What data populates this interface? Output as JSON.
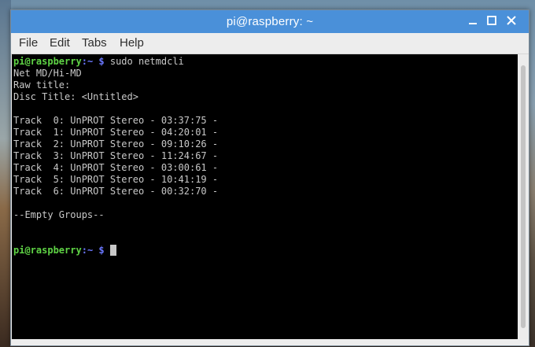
{
  "window": {
    "title": "pi@raspberry: ~"
  },
  "menu": {
    "file": "File",
    "edit": "Edit",
    "tabs": "Tabs",
    "help": "Help"
  },
  "terminal": {
    "prompt_user": "pi@raspberry",
    "prompt_sep": ":",
    "prompt_path": "~",
    "prompt_symbol": " $",
    "command": " sudo netmdcli",
    "lines": [
      "Net MD/Hi-MD",
      "Raw title:",
      "Disc Title: <Untitled>",
      "",
      "Track  0: UnPROT Stereo - 03:37:75 -",
      "Track  1: UnPROT Stereo - 04:20:01 -",
      "Track  2: UnPROT Stereo - 09:10:26 -",
      "Track  3: UnPROT Stereo - 11:24:67 -",
      "Track  4: UnPROT Stereo - 03:00:61 -",
      "Track  5: UnPROT Stereo - 10:41:19 -",
      "Track  6: UnPROT Stereo - 00:32:70 -",
      "",
      "--Empty Groups--"
    ]
  },
  "colors": {
    "titlebar": "#4a90d9",
    "prompt_user": "#5fd345",
    "prompt_path": "#6b78ff",
    "terminal_bg": "#000000",
    "terminal_fg": "#c8c8c8"
  },
  "icons": {
    "minimize": "minimize-icon",
    "maximize": "maximize-icon",
    "close": "close-icon"
  }
}
